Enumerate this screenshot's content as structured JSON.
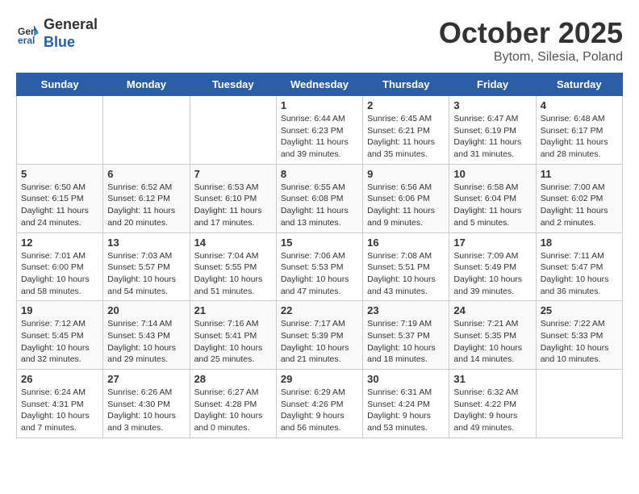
{
  "header": {
    "logo_general": "General",
    "logo_blue": "Blue",
    "month_title": "October 2025",
    "location": "Bytom, Silesia, Poland"
  },
  "weekdays": [
    "Sunday",
    "Monday",
    "Tuesday",
    "Wednesday",
    "Thursday",
    "Friday",
    "Saturday"
  ],
  "weeks": [
    [
      {
        "day": "",
        "info": ""
      },
      {
        "day": "",
        "info": ""
      },
      {
        "day": "",
        "info": ""
      },
      {
        "day": "1",
        "info": "Sunrise: 6:44 AM\nSunset: 6:23 PM\nDaylight: 11 hours\nand 39 minutes."
      },
      {
        "day": "2",
        "info": "Sunrise: 6:45 AM\nSunset: 6:21 PM\nDaylight: 11 hours\nand 35 minutes."
      },
      {
        "day": "3",
        "info": "Sunrise: 6:47 AM\nSunset: 6:19 PM\nDaylight: 11 hours\nand 31 minutes."
      },
      {
        "day": "4",
        "info": "Sunrise: 6:48 AM\nSunset: 6:17 PM\nDaylight: 11 hours\nand 28 minutes."
      }
    ],
    [
      {
        "day": "5",
        "info": "Sunrise: 6:50 AM\nSunset: 6:15 PM\nDaylight: 11 hours\nand 24 minutes."
      },
      {
        "day": "6",
        "info": "Sunrise: 6:52 AM\nSunset: 6:12 PM\nDaylight: 11 hours\nand 20 minutes."
      },
      {
        "day": "7",
        "info": "Sunrise: 6:53 AM\nSunset: 6:10 PM\nDaylight: 11 hours\nand 17 minutes."
      },
      {
        "day": "8",
        "info": "Sunrise: 6:55 AM\nSunset: 6:08 PM\nDaylight: 11 hours\nand 13 minutes."
      },
      {
        "day": "9",
        "info": "Sunrise: 6:56 AM\nSunset: 6:06 PM\nDaylight: 11 hours\nand 9 minutes."
      },
      {
        "day": "10",
        "info": "Sunrise: 6:58 AM\nSunset: 6:04 PM\nDaylight: 11 hours\nand 5 minutes."
      },
      {
        "day": "11",
        "info": "Sunrise: 7:00 AM\nSunset: 6:02 PM\nDaylight: 11 hours\nand 2 minutes."
      }
    ],
    [
      {
        "day": "12",
        "info": "Sunrise: 7:01 AM\nSunset: 6:00 PM\nDaylight: 10 hours\nand 58 minutes."
      },
      {
        "day": "13",
        "info": "Sunrise: 7:03 AM\nSunset: 5:57 PM\nDaylight: 10 hours\nand 54 minutes."
      },
      {
        "day": "14",
        "info": "Sunrise: 7:04 AM\nSunset: 5:55 PM\nDaylight: 10 hours\nand 51 minutes."
      },
      {
        "day": "15",
        "info": "Sunrise: 7:06 AM\nSunset: 5:53 PM\nDaylight: 10 hours\nand 47 minutes."
      },
      {
        "day": "16",
        "info": "Sunrise: 7:08 AM\nSunset: 5:51 PM\nDaylight: 10 hours\nand 43 minutes."
      },
      {
        "day": "17",
        "info": "Sunrise: 7:09 AM\nSunset: 5:49 PM\nDaylight: 10 hours\nand 39 minutes."
      },
      {
        "day": "18",
        "info": "Sunrise: 7:11 AM\nSunset: 5:47 PM\nDaylight: 10 hours\nand 36 minutes."
      }
    ],
    [
      {
        "day": "19",
        "info": "Sunrise: 7:12 AM\nSunset: 5:45 PM\nDaylight: 10 hours\nand 32 minutes."
      },
      {
        "day": "20",
        "info": "Sunrise: 7:14 AM\nSunset: 5:43 PM\nDaylight: 10 hours\nand 29 minutes."
      },
      {
        "day": "21",
        "info": "Sunrise: 7:16 AM\nSunset: 5:41 PM\nDaylight: 10 hours\nand 25 minutes."
      },
      {
        "day": "22",
        "info": "Sunrise: 7:17 AM\nSunset: 5:39 PM\nDaylight: 10 hours\nand 21 minutes."
      },
      {
        "day": "23",
        "info": "Sunrise: 7:19 AM\nSunset: 5:37 PM\nDaylight: 10 hours\nand 18 minutes."
      },
      {
        "day": "24",
        "info": "Sunrise: 7:21 AM\nSunset: 5:35 PM\nDaylight: 10 hours\nand 14 minutes."
      },
      {
        "day": "25",
        "info": "Sunrise: 7:22 AM\nSunset: 5:33 PM\nDaylight: 10 hours\nand 10 minutes."
      }
    ],
    [
      {
        "day": "26",
        "info": "Sunrise: 6:24 AM\nSunset: 4:31 PM\nDaylight: 10 hours\nand 7 minutes."
      },
      {
        "day": "27",
        "info": "Sunrise: 6:26 AM\nSunset: 4:30 PM\nDaylight: 10 hours\nand 3 minutes."
      },
      {
        "day": "28",
        "info": "Sunrise: 6:27 AM\nSunset: 4:28 PM\nDaylight: 10 hours\nand 0 minutes."
      },
      {
        "day": "29",
        "info": "Sunrise: 6:29 AM\nSunset: 4:26 PM\nDaylight: 9 hours\nand 56 minutes."
      },
      {
        "day": "30",
        "info": "Sunrise: 6:31 AM\nSunset: 4:24 PM\nDaylight: 9 hours\nand 53 minutes."
      },
      {
        "day": "31",
        "info": "Sunrise: 6:32 AM\nSunset: 4:22 PM\nDaylight: 9 hours\nand 49 minutes."
      },
      {
        "day": "",
        "info": ""
      }
    ]
  ]
}
